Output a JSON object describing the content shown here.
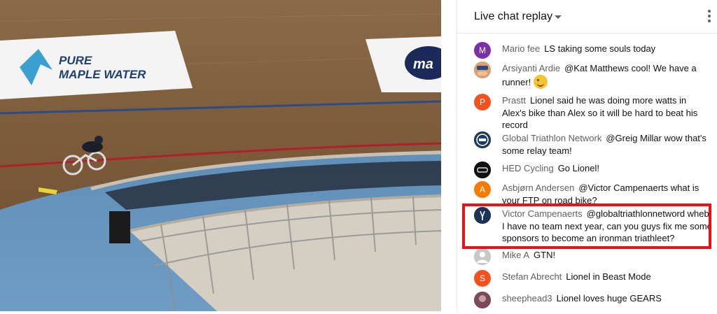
{
  "video": {
    "sponsor_1_line1": "PURE",
    "sponsor_1_line2": "MAPLE WATER",
    "sponsor_2_text": "ma"
  },
  "chat": {
    "title": "Live chat replay",
    "messages": [
      {
        "author": "Mario fee",
        "text": "LS taking some souls today",
        "avatar_letter": "M",
        "avatar_color": "#7b2fa8"
      },
      {
        "author": "Arsiyanti Ardie",
        "text": "@Kat Matthews cool! We have a runner!",
        "avatar_letter": "",
        "avatar_color": "#d97b3a",
        "emoji": "wink-emoji"
      },
      {
        "author": "Prastt",
        "text": "Lionel said he was doing more watts in Alex's bike than Alex so it will be hard to beat his record",
        "avatar_letter": "P",
        "avatar_color": "#f4511e"
      },
      {
        "author": "Global Triathlon Network",
        "text": "@Greig Millar wow that's some relay team!",
        "avatar_letter": "",
        "avatar_color": "#1d3c5a"
      },
      {
        "author": "HED Cycling",
        "text": "Go Lionel!",
        "avatar_letter": "",
        "avatar_color": "#111111"
      },
      {
        "author": "Asbjørn Andersen",
        "text": "@Victor Campenaerts what is your FTP on road bike?",
        "avatar_letter": "A",
        "avatar_color": "#f57c00"
      },
      {
        "author": "Victor Campenaerts",
        "text": "@globaltriathlonnetword wheb I have no team next year, can you guys fix me some sponsors to become an ironman triathleet?",
        "avatar_letter": "",
        "avatar_color": "#1c3556"
      },
      {
        "author": "Mike A",
        "text": "GTN!",
        "avatar_letter": "",
        "avatar_color": "#b0b0b0"
      },
      {
        "author": "Stefan Abrecht",
        "text": "Lionel in Beast Mode",
        "avatar_letter": "S",
        "avatar_color": "#f4511e"
      },
      {
        "author": "sheephead3",
        "text": "Lionel loves huge GEARS",
        "avatar_letter": "",
        "avatar_color": "#8a5a6a"
      }
    ],
    "highlight_color": "#e8121b"
  }
}
